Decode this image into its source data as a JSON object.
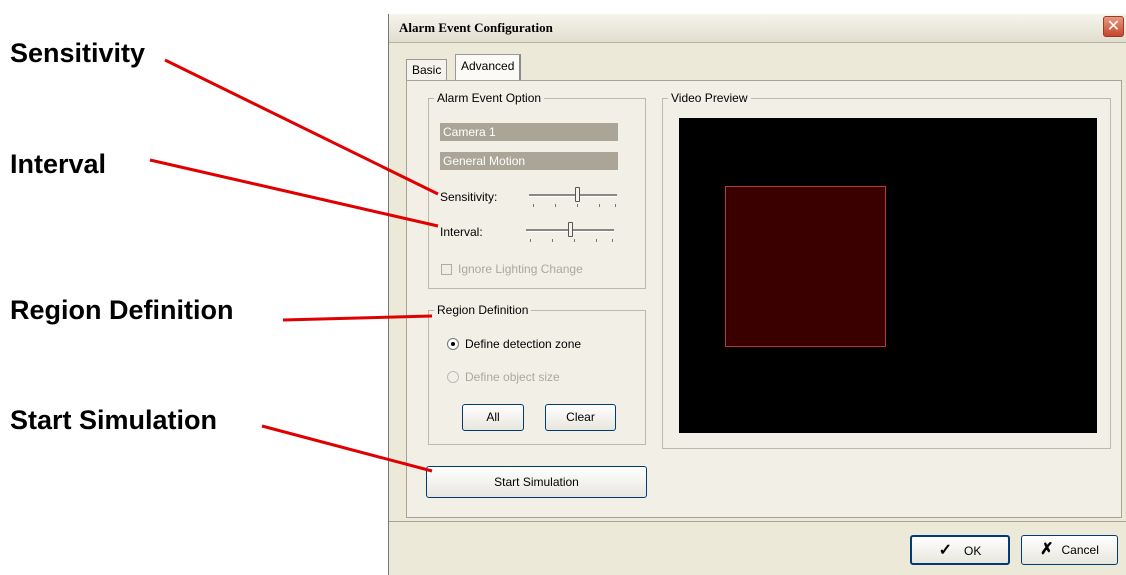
{
  "callouts": {
    "sensitivity": "Sensitivity",
    "interval": "Interval",
    "region_definition": "Region Definition",
    "start_simulation": "Start Simulation"
  },
  "window": {
    "title": "Alarm Event Configuration",
    "close_glyph": "✕"
  },
  "tabs": [
    {
      "label": "Basic",
      "selected": false
    },
    {
      "label": "Advanced",
      "selected": true
    }
  ],
  "alarm_event_option": {
    "legend": "Alarm Event Option",
    "camera": "Camera 1",
    "event_type": "General Motion",
    "sensitivity_label": "Sensitivity:",
    "sensitivity_level": 0.55,
    "interval_label": "Interval:",
    "interval_level": 0.5,
    "ignore_lighting_label": "Ignore Lighting Change",
    "ignore_lighting_checked": false
  },
  "region_definition": {
    "legend": "Region Definition",
    "option_zone": "Define detection zone",
    "option_size": "Define object size",
    "selected": "zone",
    "all_label": "All",
    "clear_label": "Clear"
  },
  "start_simulation_label": "Start Simulation",
  "video_preview": {
    "legend": "Video Preview"
  },
  "footer": {
    "ok_label": "OK",
    "cancel_label": "Cancel",
    "ok_icon": "checkmark-icon",
    "cancel_icon": "x-mark-icon"
  },
  "colors": {
    "callout_line": "#e00000",
    "zone_fill": "#3a0000",
    "zone_border": "#b23c3c"
  }
}
